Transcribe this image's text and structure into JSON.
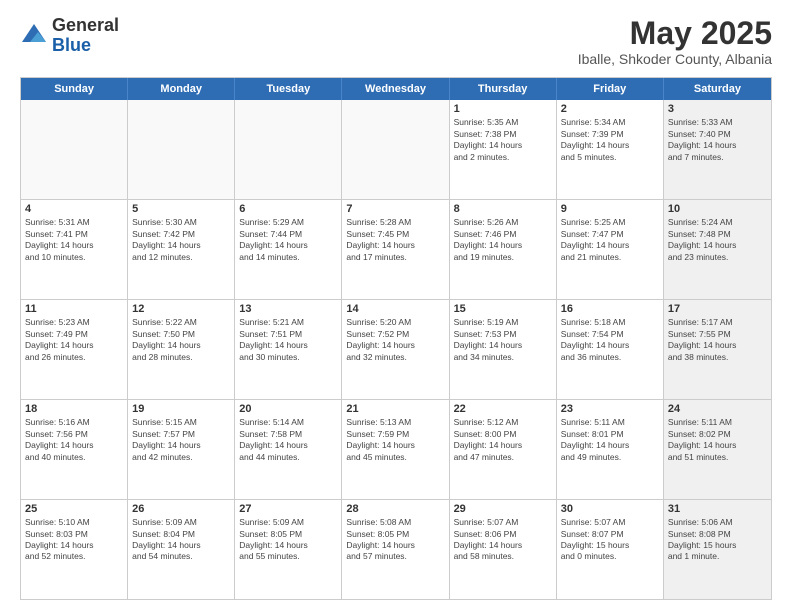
{
  "header": {
    "logo_general": "General",
    "logo_blue": "Blue",
    "main_title": "May 2025",
    "subtitle": "Iballe, Shkoder County, Albania"
  },
  "calendar": {
    "days_of_week": [
      "Sunday",
      "Monday",
      "Tuesday",
      "Wednesday",
      "Thursday",
      "Friday",
      "Saturday"
    ],
    "rows": [
      [
        {
          "num": "",
          "text": "",
          "shaded": true
        },
        {
          "num": "",
          "text": "",
          "shaded": true
        },
        {
          "num": "",
          "text": "",
          "shaded": true
        },
        {
          "num": "",
          "text": "",
          "shaded": true
        },
        {
          "num": "1",
          "text": "Sunrise: 5:35 AM\nSunset: 7:38 PM\nDaylight: 14 hours\nand 2 minutes.",
          "shaded": false
        },
        {
          "num": "2",
          "text": "Sunrise: 5:34 AM\nSunset: 7:39 PM\nDaylight: 14 hours\nand 5 minutes.",
          "shaded": false
        },
        {
          "num": "3",
          "text": "Sunrise: 5:33 AM\nSunset: 7:40 PM\nDaylight: 14 hours\nand 7 minutes.",
          "shaded": true
        }
      ],
      [
        {
          "num": "4",
          "text": "Sunrise: 5:31 AM\nSunset: 7:41 PM\nDaylight: 14 hours\nand 10 minutes.",
          "shaded": false
        },
        {
          "num": "5",
          "text": "Sunrise: 5:30 AM\nSunset: 7:42 PM\nDaylight: 14 hours\nand 12 minutes.",
          "shaded": false
        },
        {
          "num": "6",
          "text": "Sunrise: 5:29 AM\nSunset: 7:44 PM\nDaylight: 14 hours\nand 14 minutes.",
          "shaded": false
        },
        {
          "num": "7",
          "text": "Sunrise: 5:28 AM\nSunset: 7:45 PM\nDaylight: 14 hours\nand 17 minutes.",
          "shaded": false
        },
        {
          "num": "8",
          "text": "Sunrise: 5:26 AM\nSunset: 7:46 PM\nDaylight: 14 hours\nand 19 minutes.",
          "shaded": false
        },
        {
          "num": "9",
          "text": "Sunrise: 5:25 AM\nSunset: 7:47 PM\nDaylight: 14 hours\nand 21 minutes.",
          "shaded": false
        },
        {
          "num": "10",
          "text": "Sunrise: 5:24 AM\nSunset: 7:48 PM\nDaylight: 14 hours\nand 23 minutes.",
          "shaded": true
        }
      ],
      [
        {
          "num": "11",
          "text": "Sunrise: 5:23 AM\nSunset: 7:49 PM\nDaylight: 14 hours\nand 26 minutes.",
          "shaded": false
        },
        {
          "num": "12",
          "text": "Sunrise: 5:22 AM\nSunset: 7:50 PM\nDaylight: 14 hours\nand 28 minutes.",
          "shaded": false
        },
        {
          "num": "13",
          "text": "Sunrise: 5:21 AM\nSunset: 7:51 PM\nDaylight: 14 hours\nand 30 minutes.",
          "shaded": false
        },
        {
          "num": "14",
          "text": "Sunrise: 5:20 AM\nSunset: 7:52 PM\nDaylight: 14 hours\nand 32 minutes.",
          "shaded": false
        },
        {
          "num": "15",
          "text": "Sunrise: 5:19 AM\nSunset: 7:53 PM\nDaylight: 14 hours\nand 34 minutes.",
          "shaded": false
        },
        {
          "num": "16",
          "text": "Sunrise: 5:18 AM\nSunset: 7:54 PM\nDaylight: 14 hours\nand 36 minutes.",
          "shaded": false
        },
        {
          "num": "17",
          "text": "Sunrise: 5:17 AM\nSunset: 7:55 PM\nDaylight: 14 hours\nand 38 minutes.",
          "shaded": true
        }
      ],
      [
        {
          "num": "18",
          "text": "Sunrise: 5:16 AM\nSunset: 7:56 PM\nDaylight: 14 hours\nand 40 minutes.",
          "shaded": false
        },
        {
          "num": "19",
          "text": "Sunrise: 5:15 AM\nSunset: 7:57 PM\nDaylight: 14 hours\nand 42 minutes.",
          "shaded": false
        },
        {
          "num": "20",
          "text": "Sunrise: 5:14 AM\nSunset: 7:58 PM\nDaylight: 14 hours\nand 44 minutes.",
          "shaded": false
        },
        {
          "num": "21",
          "text": "Sunrise: 5:13 AM\nSunset: 7:59 PM\nDaylight: 14 hours\nand 45 minutes.",
          "shaded": false
        },
        {
          "num": "22",
          "text": "Sunrise: 5:12 AM\nSunset: 8:00 PM\nDaylight: 14 hours\nand 47 minutes.",
          "shaded": false
        },
        {
          "num": "23",
          "text": "Sunrise: 5:11 AM\nSunset: 8:01 PM\nDaylight: 14 hours\nand 49 minutes.",
          "shaded": false
        },
        {
          "num": "24",
          "text": "Sunrise: 5:11 AM\nSunset: 8:02 PM\nDaylight: 14 hours\nand 51 minutes.",
          "shaded": true
        }
      ],
      [
        {
          "num": "25",
          "text": "Sunrise: 5:10 AM\nSunset: 8:03 PM\nDaylight: 14 hours\nand 52 minutes.",
          "shaded": false
        },
        {
          "num": "26",
          "text": "Sunrise: 5:09 AM\nSunset: 8:04 PM\nDaylight: 14 hours\nand 54 minutes.",
          "shaded": false
        },
        {
          "num": "27",
          "text": "Sunrise: 5:09 AM\nSunset: 8:05 PM\nDaylight: 14 hours\nand 55 minutes.",
          "shaded": false
        },
        {
          "num": "28",
          "text": "Sunrise: 5:08 AM\nSunset: 8:05 PM\nDaylight: 14 hours\nand 57 minutes.",
          "shaded": false
        },
        {
          "num": "29",
          "text": "Sunrise: 5:07 AM\nSunset: 8:06 PM\nDaylight: 14 hours\nand 58 minutes.",
          "shaded": false
        },
        {
          "num": "30",
          "text": "Sunrise: 5:07 AM\nSunset: 8:07 PM\nDaylight: 15 hours\nand 0 minutes.",
          "shaded": false
        },
        {
          "num": "31",
          "text": "Sunrise: 5:06 AM\nSunset: 8:08 PM\nDaylight: 15 hours\nand 1 minute.",
          "shaded": true
        }
      ]
    ]
  }
}
